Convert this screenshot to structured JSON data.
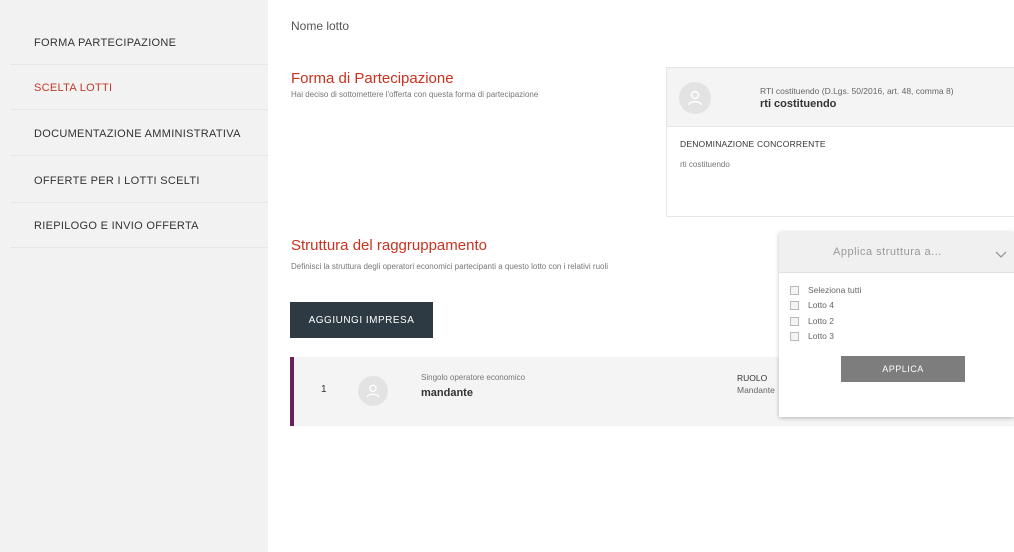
{
  "sidebar": {
    "items": [
      {
        "label": "FORMA PARTECIPAZIONE"
      },
      {
        "label": "SCELTA LOTTI"
      },
      {
        "label": "DOCUMENTAZIONE AMMINISTRATIVA"
      },
      {
        "label": "OFFERTE PER I LOTTI SCELTI"
      },
      {
        "label": "RIEPILOGO E INVIO OFFERTA"
      }
    ],
    "active_color": "#c0392b"
  },
  "main": {
    "lot_name": "Nome lotto",
    "participation": {
      "title": "Forma di Partecipazione",
      "description": "Hai deciso di sottomettere l'offerta con questa forma di partecipazione",
      "card": {
        "subtitle": "RTI costituendo (D.Lgs. 50/2016, art. 48, comma 8)",
        "name": "rti costituendo",
        "competitor_label": "DENOMINAZIONE CONCORRENTE",
        "competitor_value": "rti costituendo"
      }
    },
    "structure": {
      "title": "Struttura del raggruppamento",
      "description": "Definisci la struttura degli operatori economici partecipanti a questo lotto con i relativi ruoli",
      "add_button": "AGGIUNGI IMPRESA",
      "members": [
        {
          "index": "1",
          "type": "Singolo operatore economico",
          "name": "mandante",
          "role_label": "RUOLO",
          "role_value": "Mandante"
        }
      ]
    },
    "apply_panel": {
      "title": "Applica struttura a...",
      "options": [
        {
          "label": "Seleziona tutti"
        },
        {
          "label": "Lotto 4"
        },
        {
          "label": "Lotto 2"
        },
        {
          "label": "Lotto 3"
        }
      ],
      "button": "APPLICA"
    }
  },
  "colors": {
    "accent_red": "#c8321f",
    "dark_button": "#2d3a44",
    "row_marker": "#6b1f5e",
    "apply_button": "#7d7d7d"
  }
}
